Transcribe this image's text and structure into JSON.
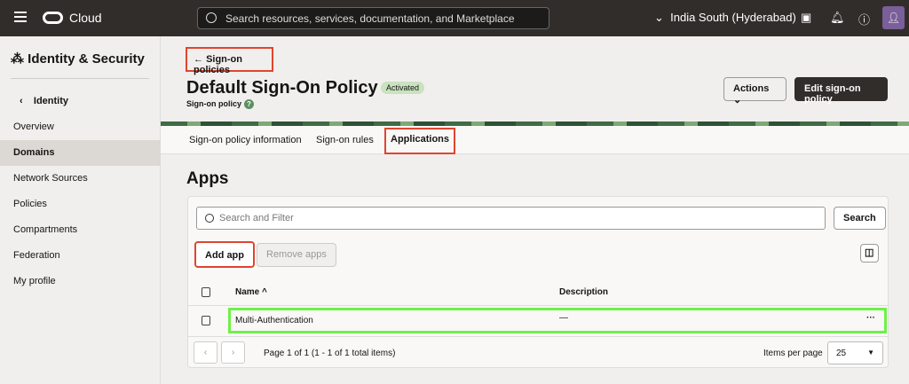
{
  "header": {
    "brand": "Cloud",
    "search_placeholder": "Search resources, services, documentation, and Marketplace",
    "region": "India South (Hyderabad)"
  },
  "sidebar": {
    "title": "Identity & Security",
    "back": "Identity",
    "items": [
      {
        "label": "Overview"
      },
      {
        "label": "Domains",
        "active": true
      },
      {
        "label": "Network Sources"
      },
      {
        "label": "Policies"
      },
      {
        "label": "Compartments"
      },
      {
        "label": "Federation"
      },
      {
        "label": "My profile"
      }
    ]
  },
  "page": {
    "breadcrumb": "Sign-on policies",
    "title": "Default Sign-On Policy",
    "status": "Activated",
    "subtitle": "Sign-on policy",
    "actions": "Actions",
    "edit": "Edit sign-on policy"
  },
  "tabs": [
    {
      "label": "Sign-on policy information"
    },
    {
      "label": "Sign-on rules"
    },
    {
      "label": "Applications"
    }
  ],
  "apps": {
    "heading": "Apps",
    "search_placeholder": "Search and Filter",
    "search_button": "Search",
    "add": "Add app",
    "remove": "Remove apps",
    "columns": {
      "name": "Name",
      "description": "Description"
    },
    "rows": [
      {
        "name": "Multi-Authentication",
        "description": "—"
      }
    ],
    "pagination": "Page 1 of 1 (1 - 1 of 1 total items)",
    "per_page_label": "Items per page",
    "per_page": "25"
  }
}
